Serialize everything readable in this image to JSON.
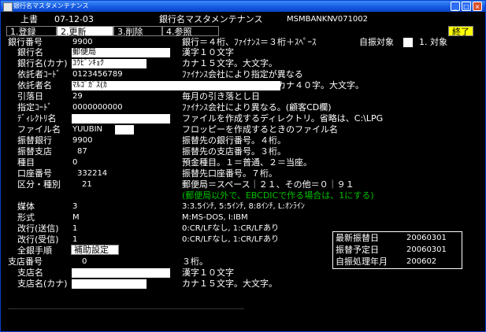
{
  "window": {
    "title": "銀行名マスタメンテナンス"
  },
  "header": {
    "left": "上書",
    "date": "07-12-03",
    "title": "銀行名マスタメンテナンス",
    "program": "MSMBANKN",
    "version": "V071002"
  },
  "menu": [
    {
      "label": "1.登録"
    },
    {
      "label": "2.更新"
    },
    {
      "label": "3.削除"
    },
    {
      "label": "4.参照"
    }
  ],
  "exit_button": "終了",
  "flag": {
    "label": "自振対象",
    "option": "1. 対象"
  },
  "rows": [
    {
      "label": "銀行番号",
      "value": "9900",
      "desc": "銀行＝４桁、ﾌｧｲﾅﾝｽ＝３桁＋ｽﾍﾟｰｽ"
    },
    {
      "label": "銀行名",
      "value": "郵便局",
      "desc": "漢字１０文字"
    },
    {
      "label": "銀行名(カナ)",
      "value": "ﾕｳﾋﾞﾝｷｮｸ",
      "desc": "カナ１５文字。大文字。"
    },
    {
      "label": "依託者ｺｰﾄﾞ",
      "value": "0123456789",
      "desc": "ﾌｧｲﾅﾝｽ会社により指定が異なる"
    },
    {
      "label": "依託者名",
      "value": "ﾏﾙｺﾞｶﾞｽ(ｶ",
      "desc": "カナ４０字。大文字。"
    },
    {
      "label": "引落日",
      "value": "29",
      "desc": "毎月の引き落とし日"
    },
    {
      "label": "指定ｺｰﾄﾞ",
      "value": "0000000000",
      "desc": "ﾌｧｲﾅﾝｽ会社により異なる。(顧客CD欄)"
    },
    {
      "label": "ﾃﾞｨﾚｸﾄﾘ名",
      "value": "",
      "desc": "ファイルを作成するディレクトリ。省略は、C:\\LPG"
    },
    {
      "label": "ファイル名",
      "value": "YUUBIN",
      "desc": "フロッピーを作成するときのファイル名"
    },
    {
      "label": "振替銀行",
      "value": "9900",
      "desc": "振替先の銀行番号。４桁。"
    },
    {
      "label": "振替支店",
      "value": "87",
      "desc": "振替先の支店番号。３桁。"
    },
    {
      "label": "種目",
      "value": "0",
      "desc": "預金種目。１＝普通、２＝当座。"
    },
    {
      "label": "口座番号",
      "value": "332214",
      "desc": "振替先口座番号。７桁。"
    },
    {
      "label": "区分・種別",
      "value": "21",
      "desc": "郵便局＝スペース｜２１、その他＝０｜９１"
    }
  ],
  "note_green": "(郵便局以外で、EBCDICで作る場合は、1にする)",
  "rows2": [
    {
      "label": "媒体",
      "value": "3",
      "desc": "3:3.5ｲﾝﾁ, 5:5ｲﾝﾁ, 8:8ｲﾝﾁ, L:ｵﾝﾗｲﾝ"
    },
    {
      "label": "形式",
      "value": "M",
      "desc": "M:MS-DOS, I:IBM"
    },
    {
      "label": "改行(送信)",
      "value": "1",
      "desc": "0:CR/LFなし, 1:CR/LFあり"
    },
    {
      "label": "改行(受信)",
      "value": "1",
      "desc": "0:CR/LFなし, 1:CR/LFあり"
    },
    {
      "label": "全銀手順",
      "button": "補助設定"
    },
    {
      "label": "支店番号",
      "value": "0",
      "desc": "３桁。"
    },
    {
      "label": "支店名",
      "value": "",
      "desc": "漢字１０文字"
    },
    {
      "label": "支店名(カナ)",
      "value": "",
      "desc": "カナ１５文字。大文字。"
    }
  ],
  "info": [
    {
      "label": "最新振替日",
      "value": "20060301"
    },
    {
      "label": "振替予定日",
      "value": "20060301"
    },
    {
      "label": "自振処理年月",
      "value": "200602"
    }
  ]
}
